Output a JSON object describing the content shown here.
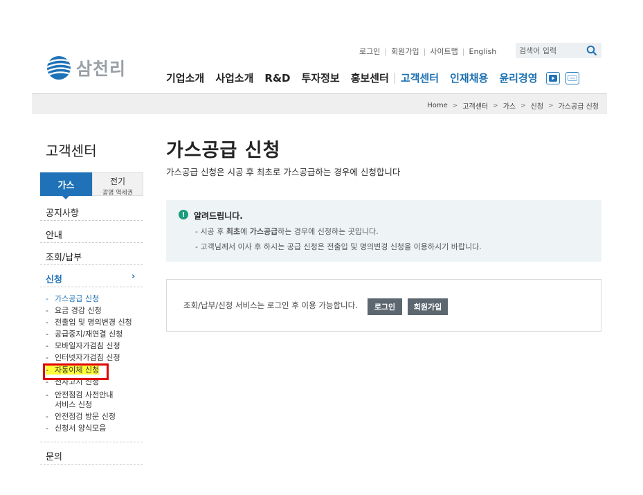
{
  "brand": {
    "name": "삼천리"
  },
  "util_links": [
    "로그인",
    "회원가입",
    "사이트맵",
    "English"
  ],
  "search": {
    "placeholder": "검색어 입력"
  },
  "gnb": {
    "items": [
      "기업소개",
      "사업소개",
      "R&D",
      "투자정보",
      "홍보센터",
      "고객센터",
      "인재채용",
      "윤리경영"
    ],
    "sns": [
      "youtube-icon",
      "blog-icon"
    ]
  },
  "breadcrumb": [
    "Home",
    "고객센터",
    "가스",
    "신청",
    "가스공급 신청"
  ],
  "lnb": {
    "title": "고객센터",
    "tab_gas": "가스",
    "tab_elec": "전기",
    "tab_elec_sub": "광명 역세권",
    "menu": [
      "공지사항",
      "안내",
      "조회/납부",
      "신청",
      "문의"
    ],
    "submenu": [
      "가스공급 신청",
      "요금 경감 신청",
      "전출입 및 명의변경 신청",
      "공급중지/재연결 신청",
      "모바일자가검침 신청",
      "인터넷자가검침 신청",
      "자동이체 신청",
      "전자고지 신청",
      "안전점검 사전안내",
      "서비스 신청",
      "안전점검 방문 신청",
      "신청서 양식모음"
    ]
  },
  "page": {
    "title": "가스공급 신청",
    "desc": "가스공급 신청은 시공 후 최초로 가스공급하는 경우에 신청합니다"
  },
  "notice": {
    "title": "알려드립니다.",
    "line1": {
      "a": "- 시공 후 ",
      "b": "최초",
      "c": "에 ",
      "d": "가스공급",
      "e": "하는 경우에 신청하는 곳입니다."
    },
    "line2": "- 고객님께서 이사 후 하시는 공급 신청은 전출입 및 명의변경 신청을 이용하시기 바랍니다."
  },
  "login_box": {
    "message": "조회/납부/신청 서비스는 로그인 후 이용 가능합니다.",
    "login": "로그인",
    "join": "회원가입"
  },
  "colors": {
    "accent": "#1f72b8",
    "highlight": "#ffff3a",
    "callout": "#e00000"
  }
}
